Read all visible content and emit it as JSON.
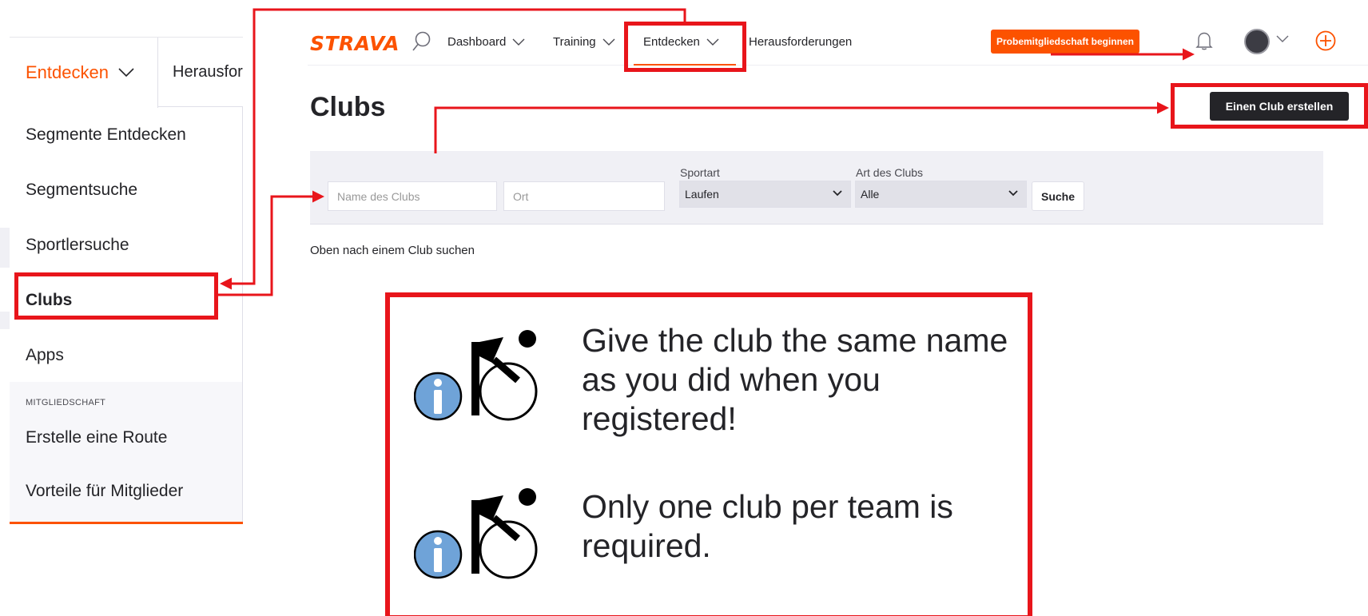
{
  "dropdown": {
    "active_tab": "Entdecken",
    "next_tab": "Herausfor",
    "items": [
      "Segmente Entdecken",
      "Segmentsuche",
      "Sportlersuche",
      "Clubs",
      "Apps"
    ],
    "membership_header": "MITGLIEDSCHAFT",
    "membership_items": [
      "Erstelle eine Route",
      "Vorteile für Mitglieder"
    ]
  },
  "nav": {
    "logo": "STRAVA",
    "dashboard": "Dashboard",
    "training": "Training",
    "explore": "Entdecken",
    "challenges": "Herausforderungen",
    "trial_button": "Probemitgliedschaft beginnen"
  },
  "page": {
    "title": "Clubs",
    "create_button": "Einen Club erstellen",
    "hint": "Oben nach einem Club suchen"
  },
  "filter": {
    "club_name_placeholder": "Name des Clubs",
    "location_placeholder": "Ort",
    "sport_label": "Sportart",
    "sport_value": "Laufen",
    "club_type_label": "Art des Clubs",
    "club_type_value": "Alle",
    "search_button": "Suche"
  },
  "info": {
    "tip1": "Give the club the same name as you did when you registered!",
    "tip2": "Only one club per team is required."
  },
  "colors": {
    "brand": "#fc5200",
    "annotation": "#e8151b",
    "info_icon": "#6fa3d8"
  }
}
